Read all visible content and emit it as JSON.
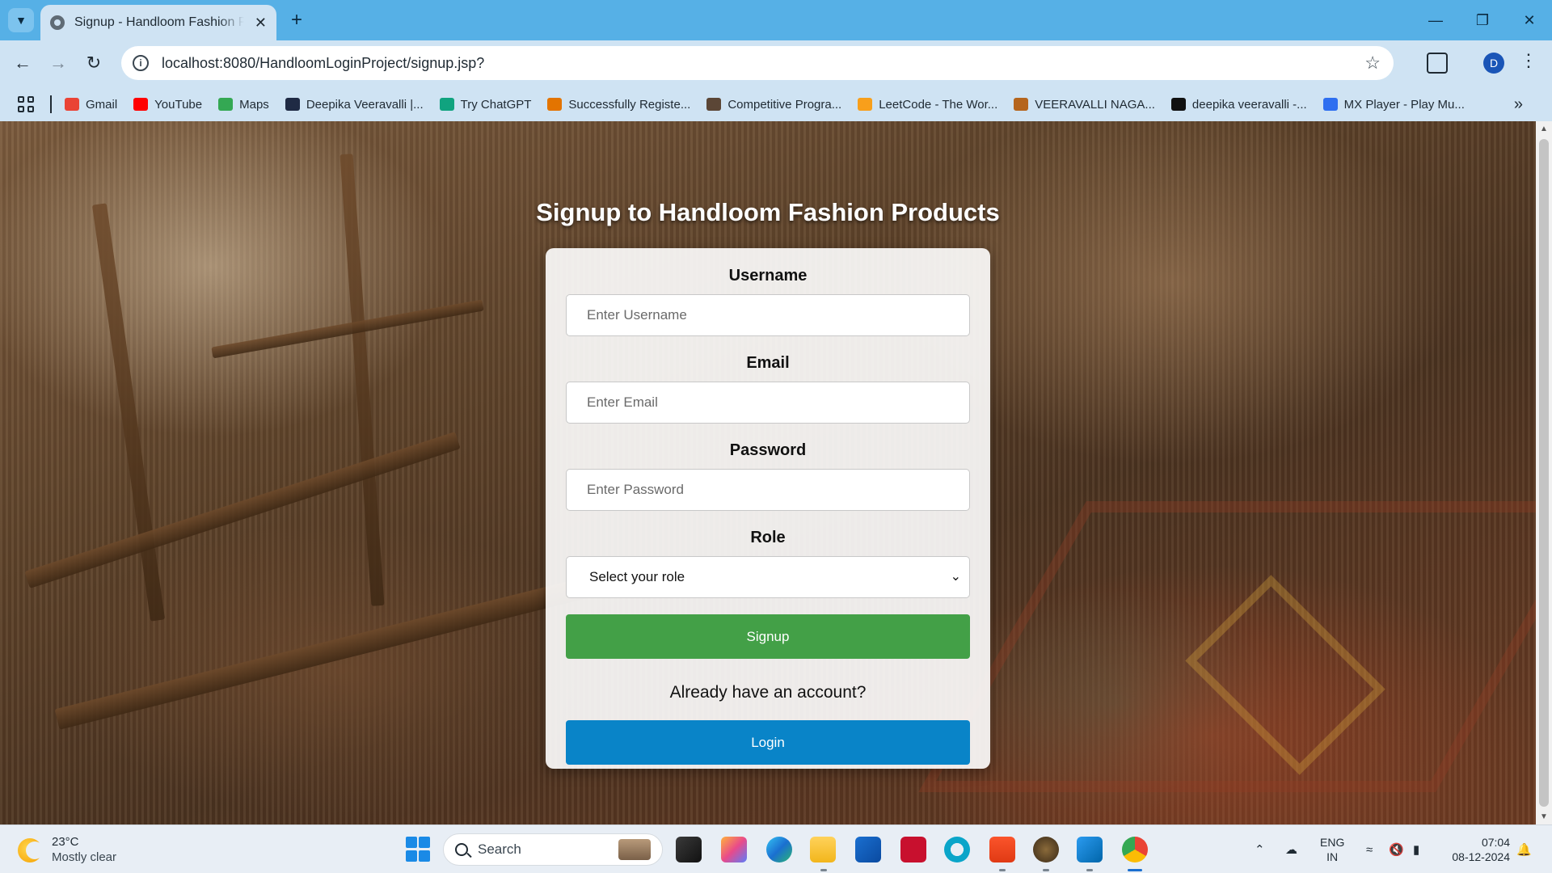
{
  "browser": {
    "tab_title": "Signup - Handloom Fashion Products",
    "url": "localhost:8080/HandloomLoginProject/signup.jsp?",
    "profile_initial": "D",
    "bookmarks": [
      {
        "label": "Gmail",
        "icon": "gmail-icon",
        "color": "#ea4335"
      },
      {
        "label": "YouTube",
        "icon": "youtube-icon",
        "color": "#ff0000"
      },
      {
        "label": "Maps",
        "icon": "maps-icon",
        "color": "#34a853"
      },
      {
        "label": "Deepika Veeravalli |...",
        "icon": "hashnode-icon",
        "color": "#1f2a44"
      },
      {
        "label": "Try ChatGPT",
        "icon": "chatgpt-icon",
        "color": "#10a37f"
      },
      {
        "label": "Successfully Registe...",
        "icon": "chart-icon",
        "color": "#e37400"
      },
      {
        "label": "Competitive Progra...",
        "icon": "cc-icon",
        "color": "#5b4636"
      },
      {
        "label": "LeetCode - The Wor...",
        "icon": "leetcode-icon",
        "color": "#f89f1b"
      },
      {
        "label": "VEERAVALLI NAGA...",
        "icon": "university-icon",
        "color": "#b5651d"
      },
      {
        "label": "deepika veeravalli -...",
        "icon": "hackerrank-icon",
        "color": "#111111"
      },
      {
        "label": "MX Player - Play Mu...",
        "icon": "mxplayer-icon",
        "color": "#2f6ff0"
      }
    ]
  },
  "page": {
    "heading": "Signup to Handloom Fashion Products",
    "form": {
      "username_label": "Username",
      "username_placeholder": "Enter Username",
      "email_label": "Email",
      "email_placeholder": "Enter Email",
      "password_label": "Password",
      "password_placeholder": "Enter Password",
      "role_label": "Role",
      "role_selected": "Select your role",
      "signup_button": "Signup",
      "account_text": "Already have an account?",
      "login_button": "Login"
    },
    "colors": {
      "signup_button": "#43a047",
      "login_button": "#0984c8"
    }
  },
  "taskbar": {
    "weather_temp": "23°C",
    "weather_condition": "Mostly clear",
    "search_label": "Search",
    "language": "ENG",
    "region": "IN",
    "time": "07:04",
    "date": "08-12-2024"
  }
}
